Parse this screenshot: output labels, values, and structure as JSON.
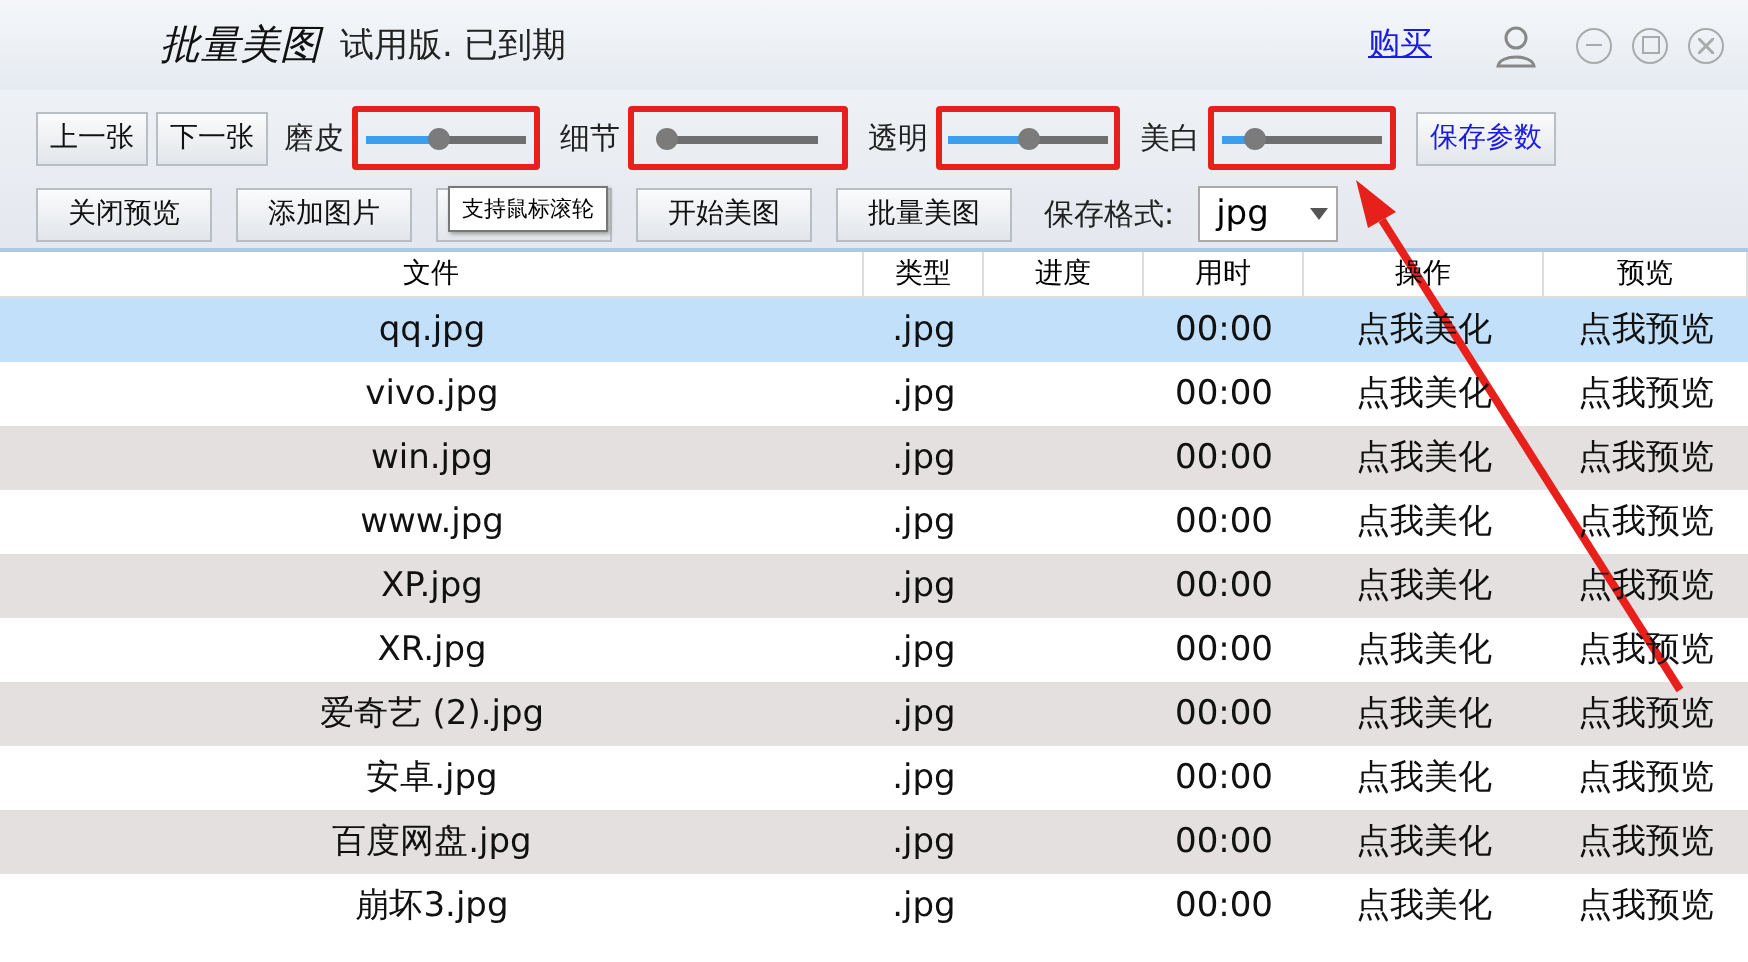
{
  "window": {
    "title": "批量美图",
    "subtitle": "试用版. 已到期",
    "buy_link": "购买"
  },
  "toolbar1": {
    "buttons": [
      "上一张",
      "下一张"
    ],
    "sliders": [
      {
        "label": "磨皮",
        "level": 0.45,
        "highlighted": true
      },
      {
        "label": "细节",
        "level": 0.05,
        "highlighted": true
      },
      {
        "label": "透明",
        "level": 0.5,
        "highlighted": true
      },
      {
        "label": "美白",
        "level": 0.2,
        "highlighted": true
      }
    ],
    "save_button": "保存参数"
  },
  "toolbar2": {
    "buttons": [
      {
        "kind": "text",
        "label": "关闭预览"
      },
      {
        "kind": "text",
        "label": "添加图片"
      },
      {
        "kind": "covered"
      },
      {
        "kind": "text",
        "label": "开始美图"
      },
      {
        "kind": "text",
        "label": "批量美图"
      }
    ],
    "format_label": "保存格式:",
    "format_value": "jpg"
  },
  "tooltip": "支持鼠标滚轮",
  "table": {
    "columns": [
      "文件",
      "类型",
      "进度",
      "用时",
      "操作",
      "预览"
    ],
    "rows": [
      {
        "file": "qq.jpg",
        "type": ".jpg",
        "time": "00:00",
        "action": "点我美化",
        "preview": "点我预览",
        "selected": true
      },
      {
        "file": "vivo.jpg",
        "type": ".jpg",
        "time": "00:00",
        "action": "点我美化",
        "preview": "点我预览",
        "selected": false
      },
      {
        "file": "win.jpg",
        "type": ".jpg",
        "time": "00:00",
        "action": "点我美化",
        "preview": "点我预览",
        "selected": false
      },
      {
        "file": "www.jpg",
        "type": ".jpg",
        "time": "00:00",
        "action": "点我美化",
        "preview": "点我预览",
        "selected": false
      },
      {
        "file": "XP.jpg",
        "type": ".jpg",
        "time": "00:00",
        "action": "点我美化",
        "preview": "点我预览",
        "selected": false
      },
      {
        "file": "XR.jpg",
        "type": ".jpg",
        "time": "00:00",
        "action": "点我美化",
        "preview": "点我预览",
        "selected": false
      },
      {
        "file": "爱奇艺 (2).jpg",
        "type": ".jpg",
        "time": "00:00",
        "action": "点我美化",
        "preview": "点我预览",
        "selected": false
      },
      {
        "file": "安卓.jpg",
        "type": ".jpg",
        "time": "00:00",
        "action": "点我美化",
        "preview": "点我预览",
        "selected": false
      },
      {
        "file": "百度网盘.jpg",
        "type": ".jpg",
        "time": "00:00",
        "action": "点我美化",
        "preview": "点我预览",
        "selected": false
      },
      {
        "file": "崩坏3.jpg",
        "type": ".jpg",
        "time": "00:00",
        "action": "点我美化",
        "preview": "点我预览",
        "selected": false
      }
    ]
  },
  "annotation": {
    "arrow": true
  }
}
